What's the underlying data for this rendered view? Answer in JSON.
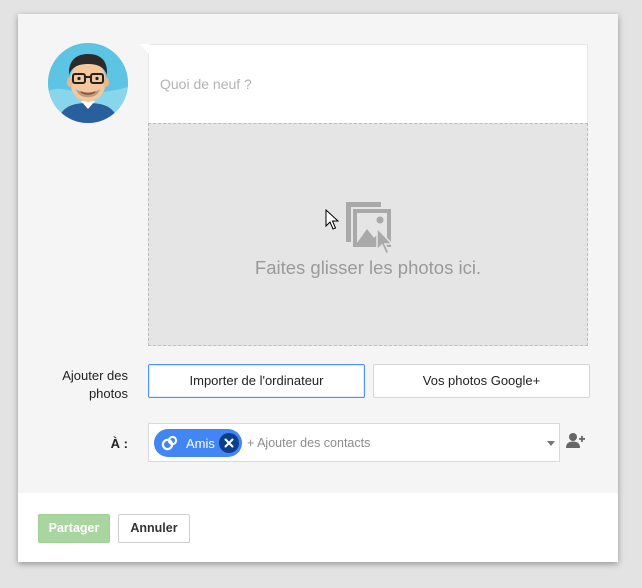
{
  "compose": {
    "placeholder": "Quoi de neuf ?",
    "value": ""
  },
  "dropzone": {
    "text": "Faites glisser les photos ici.",
    "icon": "photo-stack-icon"
  },
  "photos": {
    "label": "Ajouter des photos",
    "import_label": "Importer de l'ordinateur",
    "gplus_label": "Vos photos Google+"
  },
  "recipients": {
    "label": "À :",
    "chips": [
      {
        "label": "Amis",
        "icon": "circles-icon",
        "color": "#4285f4"
      }
    ],
    "placeholder": "+ Ajouter des contacts",
    "add_icon": "add-person-icon"
  },
  "footer": {
    "share_label": "Partager",
    "cancel_label": "Annuler"
  },
  "colors": {
    "accent": "#4285f4",
    "share_button": "#a8d5a0",
    "focus_border": "#4d90fe"
  }
}
